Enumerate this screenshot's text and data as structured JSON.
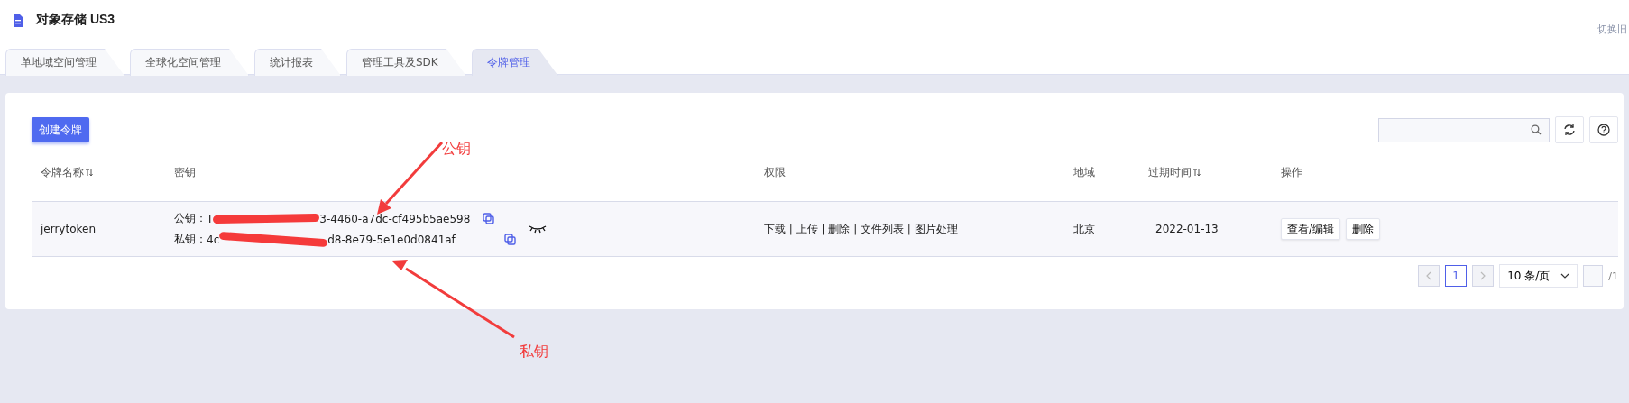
{
  "header": {
    "title": "对象存储 US3",
    "switch_link": "切换旧"
  },
  "tabs": [
    {
      "label": "单地域空间管理",
      "selected": false
    },
    {
      "label": "全球化空间管理",
      "selected": false
    },
    {
      "label": "统计报表",
      "selected": false
    },
    {
      "label": "管理工具及SDK",
      "selected": false
    },
    {
      "label": "令牌管理",
      "selected": true
    }
  ],
  "toolbar": {
    "create_button": "创建令牌"
  },
  "table": {
    "columns": [
      {
        "label": "令牌名称",
        "sortable": true
      },
      {
        "label": "密钥",
        "sortable": false
      },
      {
        "label": "权限",
        "sortable": false
      },
      {
        "label": "地域",
        "sortable": false
      },
      {
        "label": "过期时间",
        "sortable": true
      },
      {
        "label": "操作",
        "sortable": false
      }
    ],
    "rows": [
      {
        "name": "jerrytoken",
        "public_key": {
          "label": "公钥：",
          "start": "T",
          "end": "3-4460-a7dc-cf495b5ae598"
        },
        "private_key": {
          "label": "私钥：",
          "start": "4c",
          "end": "d8-8e79-5e1e0d0841af"
        },
        "permissions": "下载 | 上传 | 删除 | 文件列表 | 图片处理",
        "region": "北京",
        "expiry": "2022-01-13",
        "actions": [
          "查看/编辑",
          "删除"
        ]
      }
    ]
  },
  "pagination": {
    "pages": [
      {
        "label": "1",
        "selected": true
      }
    ],
    "prev_disabled": true,
    "next_disabled": true,
    "page_size": "10 条/页",
    "total": "/1"
  },
  "annotations": [
    {
      "label": "公钥"
    },
    {
      "label": "私钥"
    }
  ]
}
